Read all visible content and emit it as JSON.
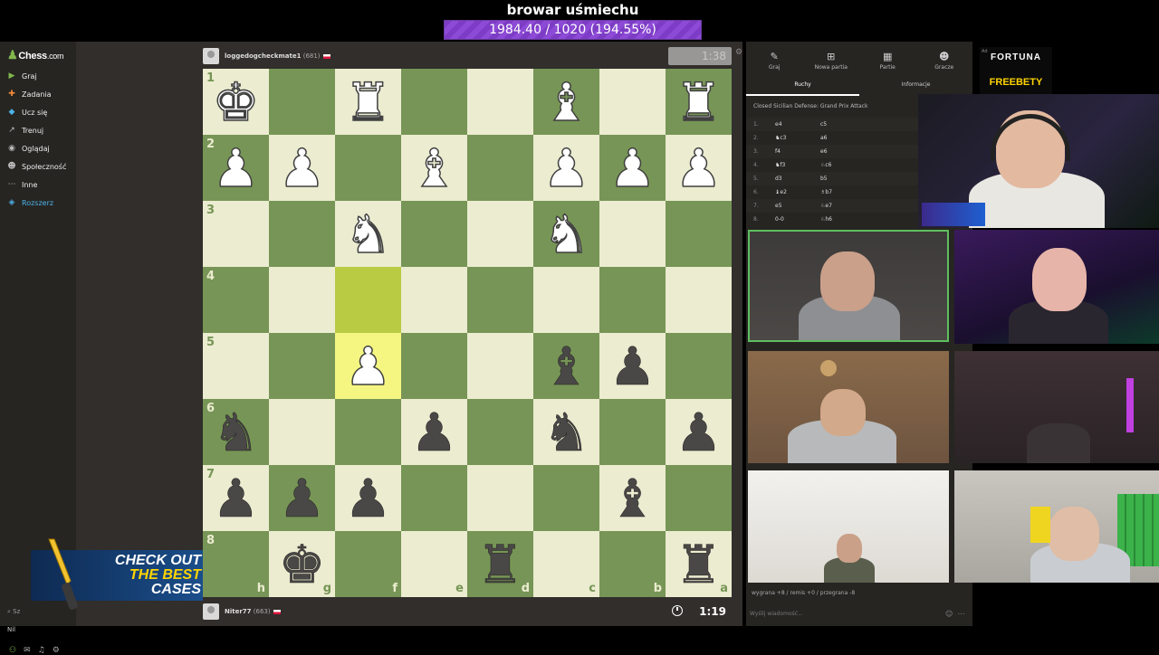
{
  "stream": {
    "title": "browar uśmiechu",
    "goal_text": "1984.40 / 1020 (194.55%)",
    "goal_progress": 1.0
  },
  "sidebar": {
    "logo": "Chess",
    "logo_suffix": ".com",
    "items": [
      {
        "label": "Graj",
        "icon": "play-icon",
        "color": "#81b64c"
      },
      {
        "label": "Zadania",
        "icon": "puzzle-icon",
        "color": "#f28a39"
      },
      {
        "label": "Ucz się",
        "icon": "learn-icon",
        "color": "#4db2e8"
      },
      {
        "label": "Trenuj",
        "icon": "train-icon",
        "color": "#bbbbbb"
      },
      {
        "label": "Oglądaj",
        "icon": "watch-icon",
        "color": "#bbbbbb"
      },
      {
        "label": "Społeczność",
        "icon": "community-icon",
        "color": "#bbbbbb"
      },
      {
        "label": "Inne",
        "icon": "more-icon",
        "color": "#bbbbbb"
      },
      {
        "label": "Rozszerz",
        "icon": "diamond-icon",
        "color": "#4db2e8"
      }
    ],
    "search_label": "Sz",
    "user_label": "Nil"
  },
  "promo": {
    "line1": "CHECK OUT",
    "line2": "THE BEST",
    "line3": "CASES"
  },
  "game": {
    "top_player": {
      "name": "loggedogcheckmate1",
      "rating": "(681)",
      "clock": "1:38"
    },
    "bottom_player": {
      "name": "Niter77",
      "rating": "(663)",
      "clock": "1:19"
    },
    "ranks": [
      "1",
      "2",
      "3",
      "4",
      "5",
      "6",
      "7",
      "8"
    ],
    "files": [
      "h",
      "g",
      "f",
      "e",
      "d",
      "c",
      "b",
      "a"
    ],
    "board": [
      [
        "wK",
        "",
        "wR",
        "",
        "",
        "wB",
        "",
        "wR"
      ],
      [
        "wP",
        "wP",
        "",
        "wB",
        "",
        "wP",
        "wP",
        "wP"
      ],
      [
        "",
        "",
        "wN",
        "",
        "",
        "wN",
        "",
        ""
      ],
      [
        "",
        "",
        "",
        "",
        "",
        "",
        "",
        ""
      ],
      [
        "",
        "",
        "wP",
        "",
        "",
        "bB",
        "bP",
        ""
      ],
      [
        "bN",
        "",
        "",
        "bP",
        "",
        "bN",
        "",
        "bP"
      ],
      [
        "bP",
        "bP",
        "bP",
        "",
        "",
        "",
        "bB",
        ""
      ],
      [
        "",
        "bK",
        "",
        "",
        "bR",
        "",
        "",
        "bR"
      ]
    ],
    "highlight": [
      [
        3,
        2
      ],
      [
        4,
        2
      ]
    ]
  },
  "panel": {
    "tabs": [
      {
        "label": "Graj",
        "icon": "play-icon"
      },
      {
        "label": "Nowa partia",
        "icon": "plus-icon"
      },
      {
        "label": "Partie",
        "icon": "board-icon"
      },
      {
        "label": "Gracze",
        "icon": "players-icon"
      }
    ],
    "subtabs": [
      "Ruchy",
      "Informacje"
    ],
    "opening": "Closed Sicilian Defense: Grand Prix Attack",
    "moves": [
      {
        "n": "1.",
        "w": "e4",
        "b": "c5"
      },
      {
        "n": "2.",
        "w": "♞c3",
        "b": "a6"
      },
      {
        "n": "3.",
        "w": "f4",
        "b": "e6"
      },
      {
        "n": "4.",
        "w": "♞f3",
        "b": "♘c6"
      },
      {
        "n": "5.",
        "w": "d3",
        "b": "b5"
      },
      {
        "n": "6.",
        "w": "♝e2",
        "b": "♗b7"
      },
      {
        "n": "7.",
        "w": "e5",
        "b": "♘e7"
      },
      {
        "n": "8.",
        "w": "0-0",
        "b": "♘h6"
      }
    ],
    "result_line": "wygrana +8 / remis +0 / przegrana -8",
    "chat_placeholder": "Wyślij wiadomość..."
  },
  "ad": {
    "badge": "Ad",
    "brand": "FORTUNA",
    "promo": "FREEBETY"
  },
  "piece_glyphs": {
    "K": "♚",
    "Q": "♛",
    "R": "♜",
    "B": "♝",
    "N": "♞",
    "P": "♟"
  },
  "colors": {
    "light": "#ebecd0",
    "dark": "#779556",
    "accent": "#81b64c",
    "goal": "#7d3cc5"
  }
}
